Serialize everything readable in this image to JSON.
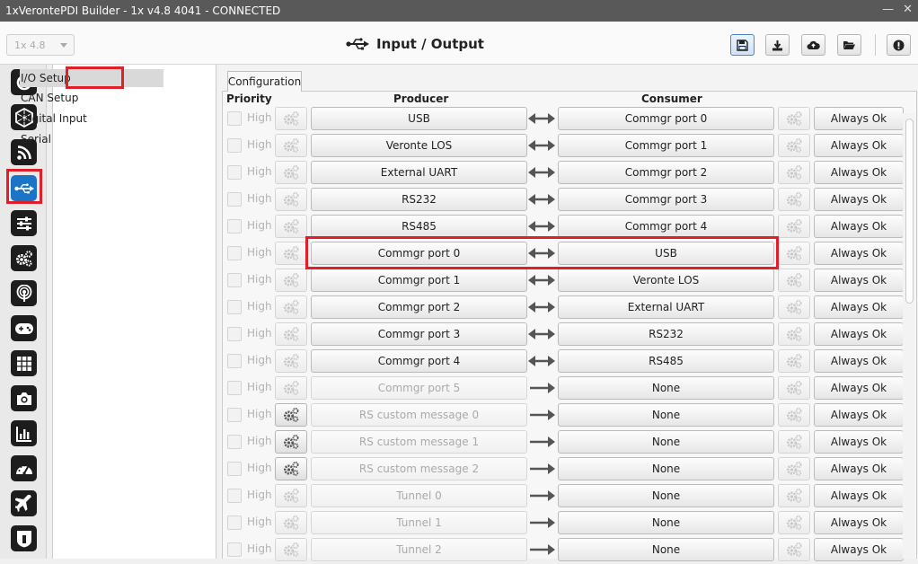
{
  "window": {
    "title": "1xVerontePDI Builder - 1x v4.8 4041 - CONNECTED"
  },
  "header": {
    "version_select": "1x 4.8",
    "page_title": "Input / Output",
    "buttons": [
      "save-icon",
      "download-icon",
      "cloud-upload-icon",
      "folder-open-icon",
      "alert-icon"
    ]
  },
  "sidebar": {
    "icons": [
      "power-icon",
      "hexagon-network-icon",
      "rss-icon",
      "usb-icon",
      "sliders-icon",
      "gears-icon",
      "podcast-icon",
      "gamepad-icon",
      "grid-icon",
      "camera-icon",
      "bar-chart-icon",
      "dashboard-icon",
      "plane-icon",
      "shield-icon"
    ],
    "selected": "usb-icon"
  },
  "nav": {
    "items": [
      {
        "label": "I/O Setup",
        "selected": true
      },
      {
        "label": "CAN Setup"
      },
      {
        "label": "Digital Input"
      },
      {
        "label": "Serial"
      }
    ]
  },
  "tabs": {
    "configuration": "Configuration"
  },
  "columns": {
    "priority": "Priority",
    "producer": "Producer",
    "consumer": "Consumer"
  },
  "rows": [
    {
      "priority": "High",
      "producer": "USB",
      "consumer": "Commgr port 0",
      "status": "Always Ok",
      "arrow": "bidirectional"
    },
    {
      "priority": "High",
      "producer": "Veronte LOS",
      "consumer": "Commgr port 1",
      "status": "Always Ok",
      "arrow": "bidirectional"
    },
    {
      "priority": "High",
      "producer": "External UART",
      "consumer": "Commgr port 2",
      "status": "Always Ok",
      "arrow": "bidirectional"
    },
    {
      "priority": "High",
      "producer": "RS232",
      "consumer": "Commgr port 3",
      "status": "Always Ok",
      "arrow": "bidirectional"
    },
    {
      "priority": "High",
      "producer": "RS485",
      "consumer": "Commgr port 4",
      "status": "Always Ok",
      "arrow": "bidirectional"
    },
    {
      "priority": "High",
      "producer": "Commgr port 0",
      "consumer": "USB",
      "status": "Always Ok",
      "arrow": "bidirectional"
    },
    {
      "priority": "High",
      "producer": "Commgr port 1",
      "consumer": "Veronte LOS",
      "status": "Always Ok",
      "arrow": "bidirectional"
    },
    {
      "priority": "High",
      "producer": "Commgr port 2",
      "consumer": "External UART",
      "status": "Always Ok",
      "arrow": "bidirectional"
    },
    {
      "priority": "High",
      "producer": "Commgr port 3",
      "consumer": "RS232",
      "status": "Always Ok",
      "arrow": "bidirectional"
    },
    {
      "priority": "High",
      "producer": "Commgr port 4",
      "consumer": "RS485",
      "status": "Always Ok",
      "arrow": "bidirectional"
    },
    {
      "priority": "High",
      "producer": "Commgr port 5",
      "consumer": "None",
      "status": "Always Ok",
      "arrow": "right",
      "producer_disabled": true
    },
    {
      "priority": "High",
      "producer": "RS custom message 0",
      "consumer": "None",
      "status": "Always Ok",
      "arrow": "right",
      "producer_disabled": true,
      "gear_active": true
    },
    {
      "priority": "High",
      "producer": "RS custom message 1",
      "consumer": "None",
      "status": "Always Ok",
      "arrow": "right",
      "producer_disabled": true,
      "gear_active": true
    },
    {
      "priority": "High",
      "producer": "RS custom message 2",
      "consumer": "None",
      "status": "Always Ok",
      "arrow": "right",
      "producer_disabled": true,
      "gear_active": true
    },
    {
      "priority": "High",
      "producer": "Tunnel 0",
      "consumer": "None",
      "status": "Always Ok",
      "arrow": "right",
      "producer_disabled": true
    },
    {
      "priority": "High",
      "producer": "Tunnel 1",
      "consumer": "None",
      "status": "Always Ok",
      "arrow": "right",
      "producer_disabled": true
    },
    {
      "priority": "High",
      "producer": "Tunnel 2",
      "consumer": "None",
      "status": "Always Ok",
      "arrow": "right",
      "producer_disabled": true
    }
  ],
  "highlight_row": 5,
  "colors": {
    "accent": "#1c74c6",
    "highlight": "#e01f26"
  }
}
